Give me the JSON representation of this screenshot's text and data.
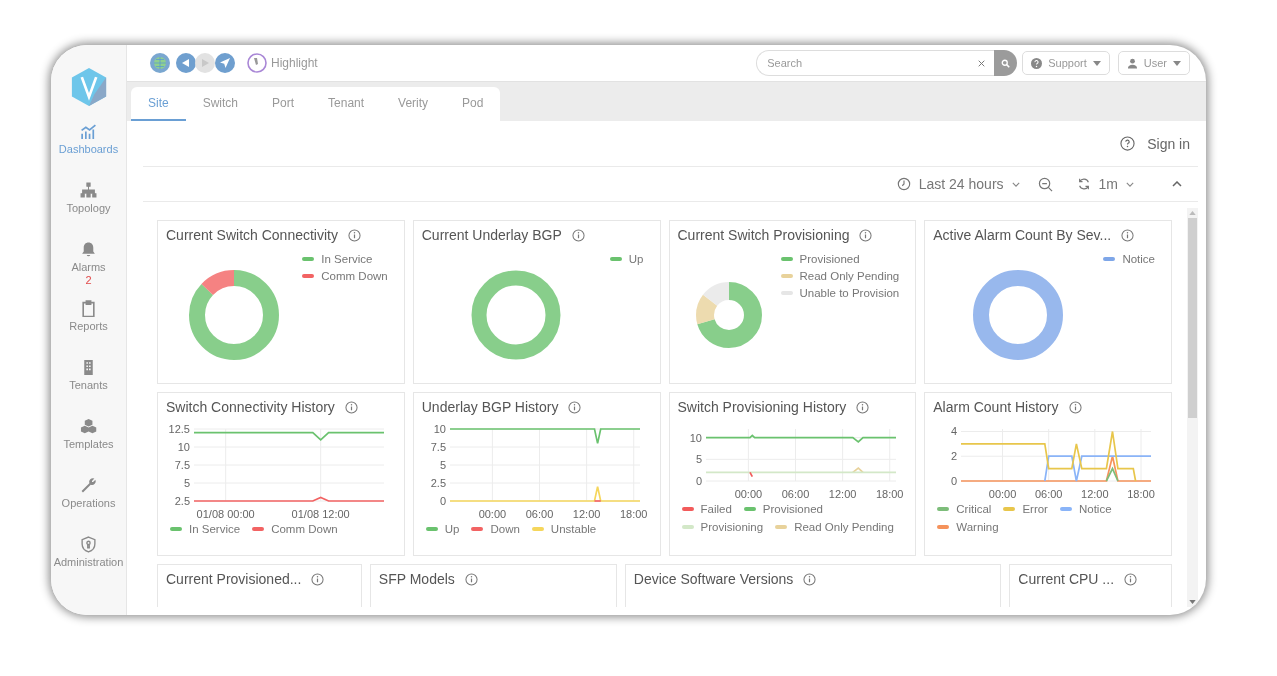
{
  "toolbar": {
    "history_buttons": [
      {
        "disabled": false
      },
      {
        "disabled": true
      }
    ],
    "highlight_label": "Highlight",
    "search": {
      "placeholder": "Search"
    },
    "support_menu": "Support",
    "user_menu": "User"
  },
  "sidebar": {
    "items": [
      {
        "label": "Dashboards",
        "selected": true
      },
      {
        "label": "Topology",
        "selected": false
      },
      {
        "label": "Alarms",
        "selected": false,
        "badge": "2"
      },
      {
        "label": "Reports",
        "selected": false
      },
      {
        "label": "Tenants",
        "selected": false
      },
      {
        "label": "Templates",
        "selected": false
      },
      {
        "label": "Operations",
        "selected": false
      },
      {
        "label": "Administration",
        "selected": false
      }
    ]
  },
  "tabs": [
    {
      "label": "Site",
      "selected": true
    },
    {
      "label": "Switch",
      "selected": false
    },
    {
      "label": "Port",
      "selected": false
    },
    {
      "label": "Tenant",
      "selected": false
    },
    {
      "label": "Verity",
      "selected": false
    },
    {
      "label": "Pod",
      "selected": false
    }
  ],
  "header": {
    "sign_in": "Sign in"
  },
  "time_bar": {
    "range": "Last 24 hours",
    "refresh": "1m"
  },
  "widget_rows": [
    [
      {
        "title": "Current Switch Connectivity",
        "kind": "donut",
        "legend": [
          {
            "label": "In Service",
            "color": "#6ac26e"
          },
          {
            "label": "Comm Down",
            "color": "#f26363"
          }
        ]
      },
      {
        "title": "Current Underlay BGP",
        "kind": "donut",
        "legend": [
          {
            "label": "Up",
            "color": "#6ac26e"
          }
        ]
      },
      {
        "title": "Current Switch Provisioning",
        "kind": "donut",
        "legend": [
          {
            "label": "Provisioned",
            "color": "#6ac26e"
          },
          {
            "label": "Read Only Pending",
            "color": "#e8d29b"
          },
          {
            "label": "Unable to Provision",
            "color": "#e6e6e6"
          }
        ]
      },
      {
        "title": "Active Alarm Count By Sev...",
        "kind": "donut",
        "legend": [
          {
            "label": "Notice",
            "color": "#7ea6e8"
          }
        ]
      }
    ],
    [
      {
        "title": "Switch Connectivity History",
        "kind": "line",
        "chart_data": {
          "type": "line",
          "categories": [
            null,
            null,
            null,
            null,
            "01/08 00:00",
            null,
            null,
            null,
            null,
            null,
            null,
            null,
            null,
            null,
            null,
            null,
            "01/08 12:00",
            null,
            null,
            null,
            null,
            null,
            null,
            null,
            null
          ],
          "grid": true,
          "legend": true,
          "ylim": [
            2.5,
            12.5
          ],
          "yticks": [
            2.5,
            5,
            7.5,
            10,
            12.5
          ],
          "series": [
            {
              "name": "In Service",
              "color": "#6ac26e",
              "values": [
                12,
                12,
                12,
                12,
                12,
                12,
                12,
                12,
                12,
                12,
                12,
                12,
                12,
                12,
                12,
                12,
                11,
                12,
                12,
                12,
                12,
                12,
                12,
                12,
                12
              ]
            },
            {
              "name": "Comm Down",
              "color": "#f26363",
              "values": [
                2.5,
                2.5,
                2.5,
                2.5,
                2.5,
                2.5,
                2.5,
                2.5,
                2.5,
                2.5,
                2.5,
                2.5,
                2.5,
                2.5,
                2.5,
                2.5,
                3,
                2.5,
                2.5,
                2.5,
                2.5,
                2.5,
                2.5,
                2.5,
                2.5
              ]
            }
          ]
        }
      },
      {
        "title": "Underlay BGP History",
        "kind": "line",
        "chart_data": {
          "type": "line",
          "x": [
            -5.4,
            13,
            13.4,
            13.8,
            18.8
          ],
          "grid": true,
          "legend": true,
          "xlim": [
            -5.4,
            18.8
          ],
          "ylim": [
            0,
            10
          ],
          "xticks": [
            {
              "value": 0,
              "label": "00:00"
            },
            {
              "value": 6,
              "label": "06:00"
            },
            {
              "value": 12,
              "label": "12:00"
            },
            {
              "value": 18,
              "label": "18:00"
            }
          ],
          "yticks": [
            0,
            2.5,
            5,
            7.5,
            10
          ],
          "series": [
            {
              "name": "Up",
              "color": "#6ac26e",
              "values": [
                10,
                10,
                8,
                10,
                10
              ]
            },
            {
              "name": "Down",
              "color": "#f26363",
              "values": [
                null,
                0,
                0,
                0,
                null
              ]
            },
            {
              "name": "Unstable",
              "color": "#f5d65c",
              "values": [
                0,
                0,
                2,
                0,
                0
              ]
            }
          ]
        }
      },
      {
        "title": "Switch Provisioning History",
        "kind": "line",
        "chart_data": {
          "type": "line",
          "x": [
            -5.4,
            0.2,
            0.5,
            0.8,
            13.3,
            14,
            14.6,
            18.8
          ],
          "grid": true,
          "legend": true,
          "xlim": [
            -5.4,
            18.8
          ],
          "ylim": [
            0,
            12
          ],
          "xticks": [
            {
              "value": 0,
              "label": "00:00"
            },
            {
              "value": 6,
              "label": "06:00"
            },
            {
              "value": 12,
              "label": "12:00"
            },
            {
              "value": 18,
              "label": "18:00"
            }
          ],
          "yticks": [
            0,
            5,
            10
          ],
          "series": [
            {
              "name": "Failed",
              "color": "#f25b5b",
              "values": [
                null,
                2,
                1,
                null,
                null,
                null,
                null,
                null
              ]
            },
            {
              "name": "Provisioned",
              "color": "#6ac26e",
              "values": [
                10,
                10,
                10.5,
                10,
                10,
                9,
                10,
                10
              ]
            },
            {
              "name": "Provisioning",
              "color": "#d3e8c8",
              "values": [
                2,
                2,
                2,
                2,
                2,
                2,
                2,
                2
              ]
            },
            {
              "name": "Read Only Pending",
              "color": "#e8d29b",
              "values": [
                null,
                null,
                null,
                null,
                2,
                3,
                2,
                null
              ]
            }
          ]
        }
      },
      {
        "title": "Alarm Count History",
        "kind": "line",
        "chart_data": {
          "type": "line",
          "x": [
            -5.4,
            5.5,
            6,
            9,
            9.6,
            10.3,
            13.5,
            14.3,
            15,
            17,
            17.3,
            19.3
          ],
          "grid": true,
          "legend": true,
          "xlim": [
            -5.4,
            19.3
          ],
          "ylim": [
            0,
            4.2
          ],
          "xticks": [
            {
              "value": 0,
              "label": "00:00"
            },
            {
              "value": 6,
              "label": "06:00"
            },
            {
              "value": 12,
              "label": "12:00"
            },
            {
              "value": 18,
              "label": "18:00"
            }
          ],
          "yticks": [
            0,
            2,
            4
          ],
          "series": [
            {
              "name": "Critical",
              "color": "#7dbd7a",
              "values": [
                null,
                null,
                null,
                null,
                null,
                null,
                0,
                1,
                0,
                null,
                null,
                null
              ]
            },
            {
              "name": "Error",
              "color": "#e8c64b",
              "values": [
                3,
                3,
                1,
                1,
                3,
                1,
                1,
                4,
                1,
                1,
                0,
                null
              ]
            },
            {
              "name": "Notice",
              "color": "#8ab4f8",
              "values": [
                null,
                0,
                2,
                2,
                0,
                2,
                2,
                2,
                2,
                2,
                2,
                2
              ]
            },
            {
              "name": "Warning",
              "color": "#f5925b",
              "values": [
                0,
                0,
                0,
                0,
                0,
                0,
                0,
                2,
                0,
                0,
                0,
                0
              ]
            }
          ]
        }
      }
    ],
    [
      {
        "title": "Current Provisioned...",
        "kind": "empty"
      },
      {
        "title": "SFP Models",
        "kind": "empty"
      },
      {
        "title": "Device Software Versions",
        "kind": "empty"
      },
      {
        "title": "Current CPU ...",
        "kind": "empty"
      }
    ]
  ]
}
